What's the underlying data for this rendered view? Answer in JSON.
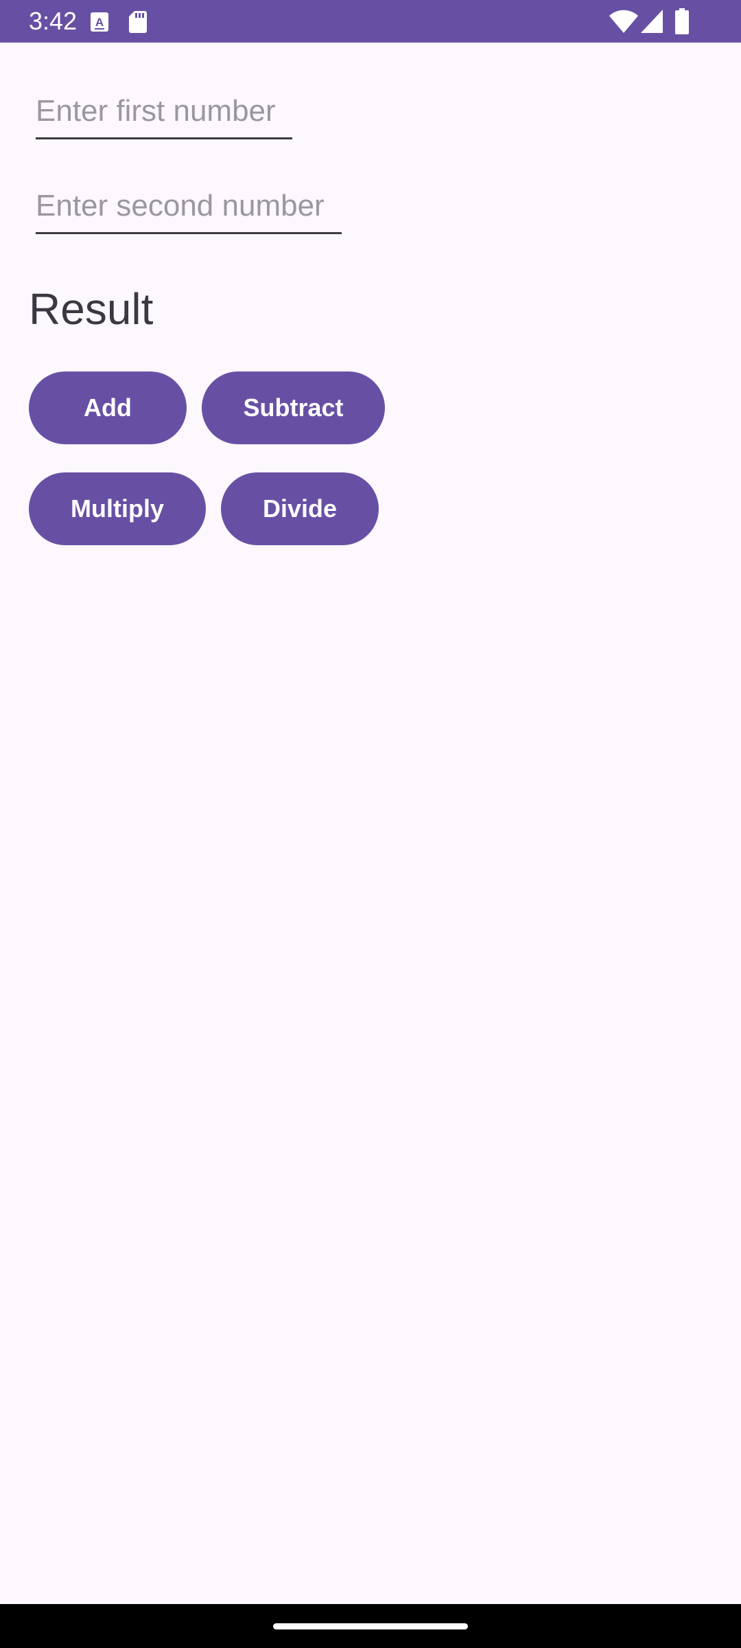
{
  "status_bar": {
    "time": "3:42",
    "icons": [
      "keyboard-a-icon",
      "sd-card-icon",
      "wifi-icon",
      "cell-signal-icon",
      "battery-icon"
    ],
    "background": "#6750a4"
  },
  "inputs": {
    "first_placeholder": "Enter first number",
    "first_value": "",
    "second_placeholder": "Enter second number",
    "second_value": ""
  },
  "result": {
    "text": "Result"
  },
  "buttons": {
    "add": "Add",
    "subtract": "Subtract",
    "multiply": "Multiply",
    "divide": "Divide"
  },
  "colors": {
    "accent": "#6750a4",
    "background": "#fdf7fe",
    "button_text": "#ffffff"
  }
}
